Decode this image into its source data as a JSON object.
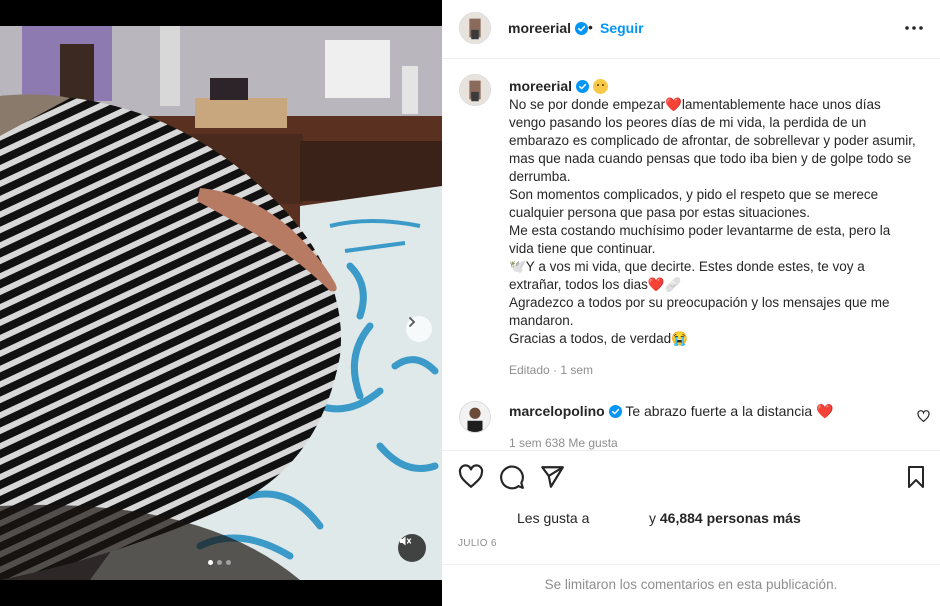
{
  "post": {
    "username": "moreerial",
    "separator": "•",
    "follow_label": "Seguir",
    "more_icon": "more-horizontal-icon"
  },
  "caption": {
    "username": "moreerial",
    "paragraphs": [
      "No se por donde empezar❤️lamentablemente hace unos días vengo pasando los peores días de mi vida, la perdida de un embarazo es complicado de afrontar, de sobrellevar y poder asumir, mas que nada cuando pensas que todo iba bien y de golpe todo se derrumba.",
      "Son momentos complicados, y pido el respeto que se merece cualquier persona que pasa por estas situaciones.",
      "Me esta costando muchísimo poder levantarme de esta, pero la vida tiene que continuar.",
      "🕊️Y a vos mi vida, que decirte. Estes donde estes, te voy a extrañar, todos los dias❤️🩹",
      "Agradezco a todos por su preocupación y los mensajes que me mandaron.",
      "Gracias a todos, de verdad😭"
    ],
    "edited": "Editado · 1 sem"
  },
  "comment": {
    "username": "marcelopolino",
    "text": "Te abrazo fuerte a la distancia ❤️",
    "meta": "1 sem   638 Me gusta"
  },
  "likes": {
    "prefix": "Les gusta a",
    "count_text": "y 46,884 personas más"
  },
  "date": "JULIO 6",
  "comments_limited": "Se limitaron los comentarios en esta publicación.",
  "colors": {
    "accent": "#0095f6",
    "verified": "#0095f6",
    "heart": "#d9112a"
  },
  "carousel": {
    "slides": 3,
    "active_index": 0
  }
}
